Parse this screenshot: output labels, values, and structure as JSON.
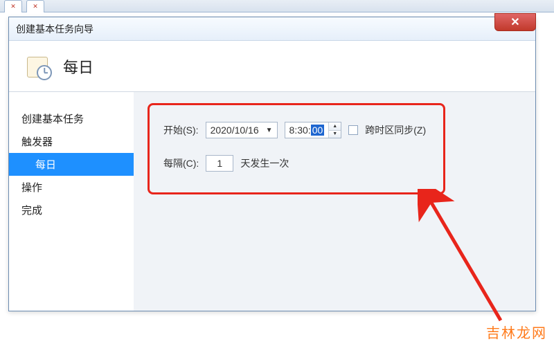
{
  "window": {
    "title": "创建基本任务向导"
  },
  "header": {
    "title": "每日"
  },
  "sidebar": {
    "items": [
      {
        "label": "创建基本任务",
        "sub": false,
        "selected": false
      },
      {
        "label": "触发器",
        "sub": false,
        "selected": false
      },
      {
        "label": "每日",
        "sub": true,
        "selected": true
      },
      {
        "label": "操作",
        "sub": false,
        "selected": false
      },
      {
        "label": "完成",
        "sub": false,
        "selected": false
      }
    ]
  },
  "form": {
    "start_label": "开始(S):",
    "date_value": "2020/10/16",
    "time_prefix": "8:30:",
    "time_selected": "00",
    "sync_label": "跨时区同步(Z)",
    "interval_label": "每隔(C):",
    "interval_value": "1",
    "interval_suffix": "天发生一次"
  },
  "watermark": "吉林龙网"
}
